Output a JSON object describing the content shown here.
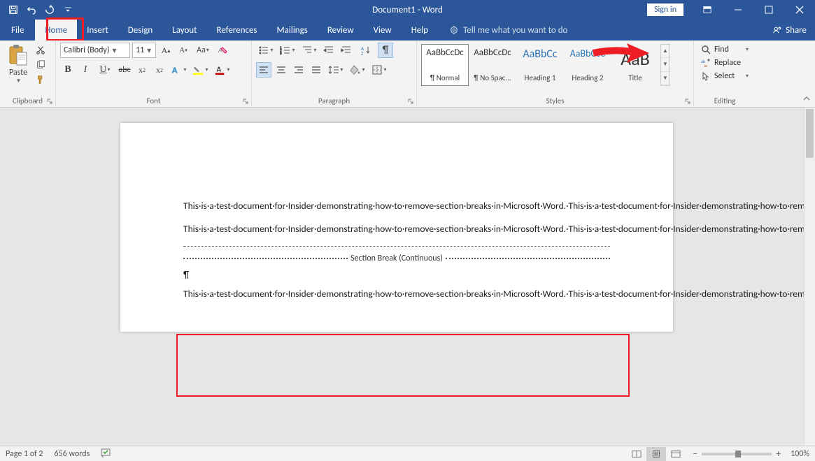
{
  "titlebar": {
    "title": "Document1  -  Word",
    "signin": "Sign in"
  },
  "tabs": {
    "file": "File",
    "home": "Home",
    "insert": "Insert",
    "design": "Design",
    "layout": "Layout",
    "references": "References",
    "mailings": "Mailings",
    "review": "Review",
    "view": "View",
    "help": "Help",
    "tellme": "Tell me what you want to do",
    "share": "Share"
  },
  "ribbon": {
    "clipboard": {
      "label": "Clipboard",
      "paste": "Paste"
    },
    "font": {
      "label": "Font",
      "fontname": "Calibri (Body)",
      "fontsize": "11"
    },
    "paragraph": {
      "label": "Paragraph"
    },
    "styles": {
      "label": "Styles",
      "items": [
        {
          "preview": "AaBbCcDc",
          "name": "¶ Normal",
          "size": "13px",
          "color": "#333",
          "selected": true
        },
        {
          "preview": "AaBbCcDc",
          "name": "¶ No Spac...",
          "size": "13px",
          "color": "#333"
        },
        {
          "preview": "AaBbCc",
          "name": "Heading 1",
          "size": "16px",
          "color": "#2e74b5"
        },
        {
          "preview": "AaBbCcC",
          "name": "Heading 2",
          "size": "14px",
          "color": "#2e74b5"
        },
        {
          "preview": "AaB",
          "name": "Title",
          "size": "26px",
          "color": "#333"
        }
      ]
    },
    "editing": {
      "label": "Editing",
      "find": "Find",
      "replace": "Replace",
      "select": "Select"
    }
  },
  "doc": {
    "para": "This·is·a·test·document·for·Insider·demonstrating·how·to·remove·section·breaks·in·Microsoft·Word.·This·is·a·test·document·for·Insider·demonstrating·how·to·remove·section·breaks·in·Microsoft·Word.·This·is·a·test·document·for·Insider·demonstrating·how·to·remove·section·breaks·in·Microsoft·Word.·This·is·a·test·document·for·Insider·demonstrating·how·to·remove·section·breaks·in·Microsoft·Word.·This·is·a·test·document·for·Insider·demonstrating·how·to·remove·section·breaks·in·Microsoft·Word.¶",
    "section_break": "Section Break (Continuous)",
    "pilcrow": "¶"
  },
  "status": {
    "page": "Page 1 of 2",
    "words": "656 words",
    "zoom": "100%"
  }
}
